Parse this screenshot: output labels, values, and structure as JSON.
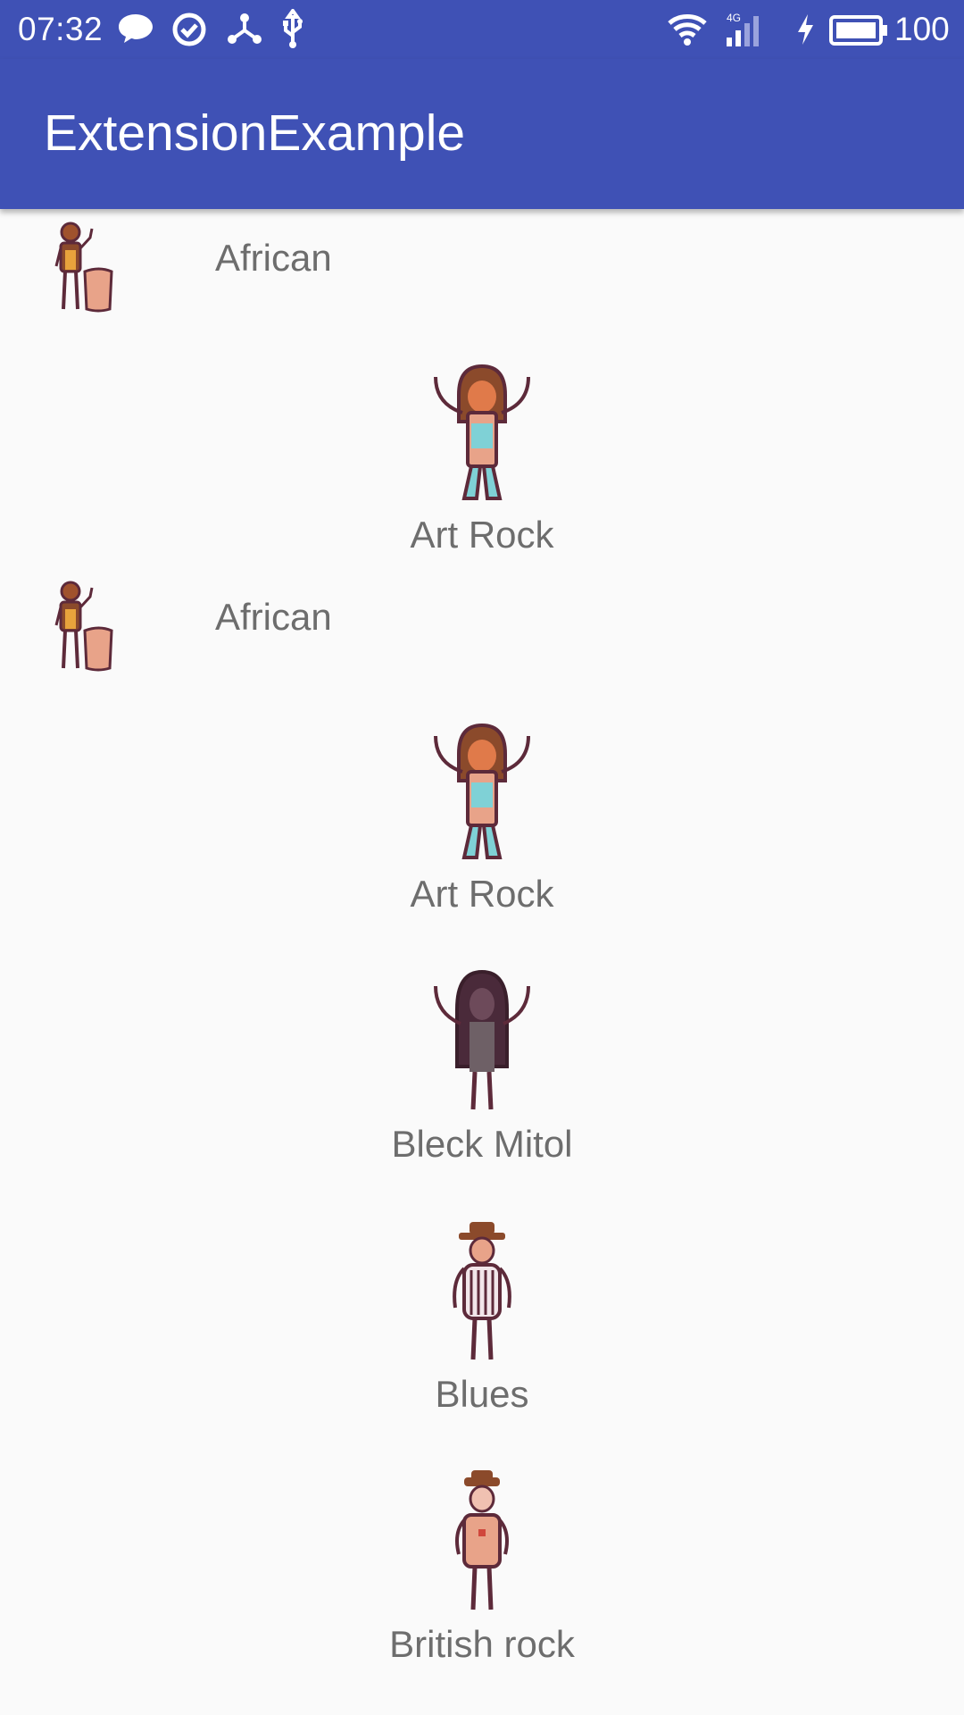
{
  "status_bar": {
    "time": "07:32",
    "battery": "100",
    "network": "4G",
    "icons": [
      "chat-bubble-icon",
      "check-circle-icon",
      "share-nodes-icon",
      "usb-icon",
      "wifi-icon",
      "signal-icon",
      "charging-icon",
      "battery-icon"
    ]
  },
  "app_bar": {
    "title": "ExtensionExample",
    "color": "#3f51b5"
  },
  "list": {
    "items": [
      {
        "label": "African",
        "icon": "african-drummer-icon",
        "layout": "left"
      },
      {
        "label": "Art Rock",
        "icon": "art-rock-figure-icon",
        "layout": "center"
      },
      {
        "label": "African",
        "icon": "african-drummer-icon",
        "layout": "left"
      },
      {
        "label": "Art Rock",
        "icon": "art-rock-figure-icon",
        "layout": "center"
      },
      {
        "label": "Bleck Mitol",
        "icon": "black-metal-figure-icon",
        "layout": "center"
      },
      {
        "label": "Blues",
        "icon": "blues-figure-icon",
        "layout": "center"
      },
      {
        "label": "British rock",
        "icon": "british-rock-figure-icon",
        "layout": "center"
      }
    ]
  }
}
